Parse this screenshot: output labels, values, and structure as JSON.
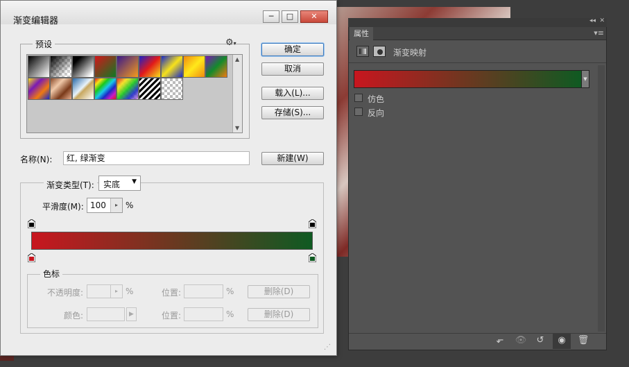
{
  "dialog": {
    "title": "渐变编辑器",
    "window_buttons": {
      "minimize": "─",
      "maximize": "□",
      "close": "✕"
    },
    "presets_legend": "预设",
    "gear_icon": "⚙",
    "buttons": {
      "ok": "确定",
      "cancel": "取消",
      "load": "载入(L)...",
      "save": "存储(S)...",
      "new": "新建(W)"
    },
    "name_label": "名称(N):",
    "name_value": "红, 绿渐变",
    "type_label": "渐变类型(T):",
    "type_value": "实底",
    "smooth_label": "平滑度(M):",
    "smooth_value": "100",
    "smooth_unit": "%",
    "gradient_colors": {
      "start": "#c8161f",
      "end": "#0f5a22"
    },
    "stops_legend": "色标",
    "opacity_label": "不透明度:",
    "opacity_unit": "%",
    "location_label": "位置:",
    "location_unit": "%",
    "delete_label": "删除(D)",
    "color_label": "颜色:",
    "preset_swatches": [
      "foreground-to-background",
      "foreground-to-transparent",
      "black-white",
      "red-green",
      "violet-orange",
      "blue-red-yellow",
      "blue-yellow-blue",
      "orange-yellow-orange",
      "violet-green-orange",
      "yellow-violet-orange-blue",
      "copper",
      "chrome",
      "spectrum",
      "transparent-rainbow",
      "transparent-stripes",
      "transparent-checker"
    ]
  },
  "properties": {
    "tab_label": "属性",
    "collapse_icon": "◂◂",
    "close_icon": "✕",
    "menu_icon": "≡",
    "layer_title": "渐变映射",
    "dither_label": "仿色",
    "reverse_label": "反向",
    "footer_icons": [
      "clip-to-layer-icon",
      "view-previous-state-icon",
      "reset-icon",
      "visibility-icon",
      "delete-icon"
    ]
  }
}
